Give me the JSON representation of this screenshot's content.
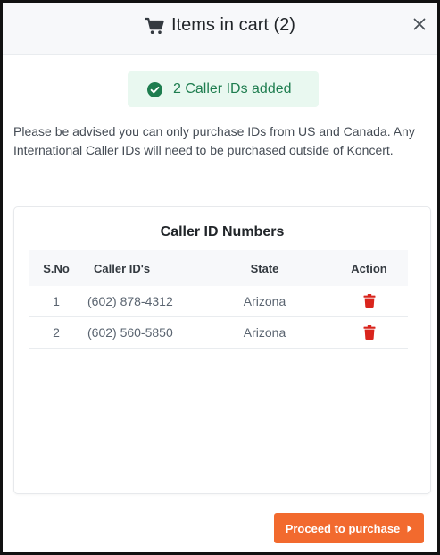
{
  "header": {
    "title": "Items in cart (2)",
    "cart_icon": "shopping-cart-icon",
    "close_icon": "close-icon"
  },
  "alert": {
    "message": "2 Caller IDs added",
    "icon": "check-circle-icon",
    "color": "#1e7d4f",
    "background": "#e9f8f0"
  },
  "note": "Please be advised you can only purchase IDs from US and Canada. Any International Caller IDs will need to be purchased outside of Koncert.",
  "table": {
    "title": "Caller ID Numbers",
    "headers": [
      "S.No",
      "Caller ID's",
      "State",
      "Action"
    ],
    "rows": [
      {
        "sno": "1",
        "caller_id": "(602) 878-4312",
        "state": "Arizona",
        "action_icon": "trash-icon"
      },
      {
        "sno": "2",
        "caller_id": "(602) 560-5850",
        "state": "Arizona",
        "action_icon": "trash-icon"
      }
    ],
    "delete_color": "#d9251d"
  },
  "footer": {
    "proceed_label": "Proceed to purchase",
    "proceed_icon": "caret-right-icon",
    "button_color": "#f26a2e"
  }
}
